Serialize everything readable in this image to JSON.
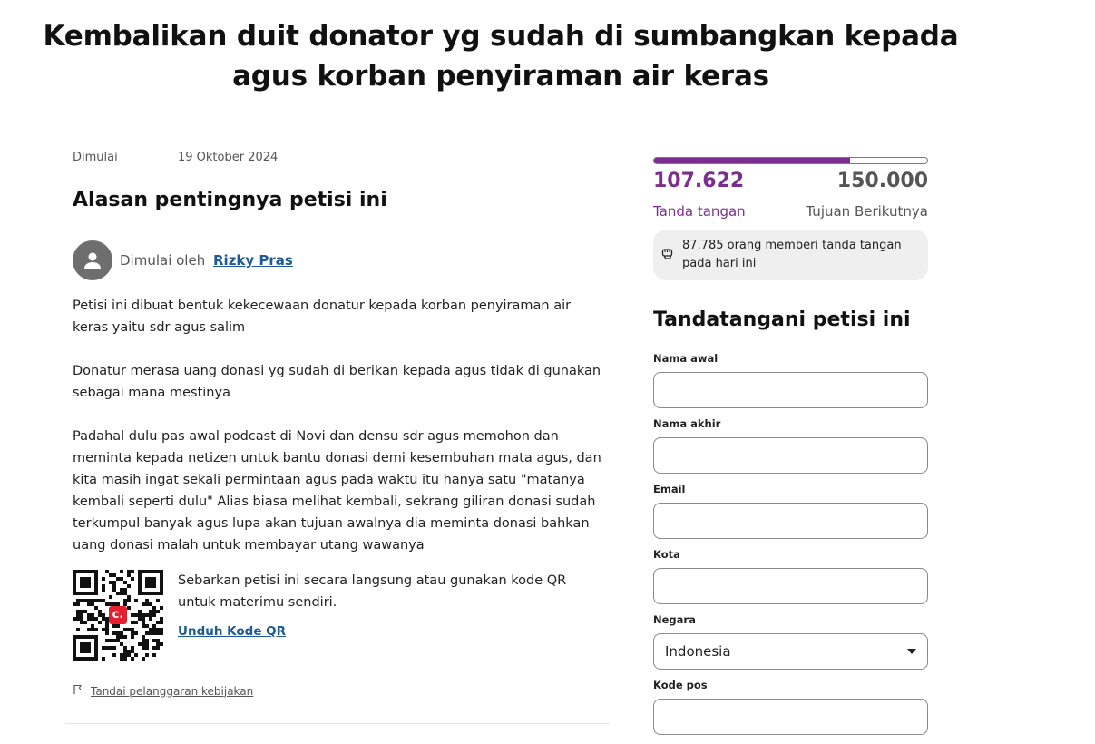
{
  "petition": {
    "title_line1": "Kembalikan duit donator yg sudah di sumbangkan kepada",
    "title_line2": "agus korban penyiraman air keras",
    "started_label": "Dimulai",
    "started_date": "19 Oktober 2024",
    "reason_title": "Alasan pentingnya petisi ini",
    "started_by_label": "Dimulai oleh",
    "author_name": "Rizky Pras",
    "paragraphs": [
      "Petisi ini dibuat bentuk kekecewaan donatur kepada korban penyiraman air keras yaitu sdr agus salim",
      "Donatur merasa uang donasi yg sudah di berikan kepada agus tidak di gunakan sebagai mana mestinya",
      "Padahal dulu pas awal podcast di Novi dan densu sdr agus memohon dan meminta kepada netizen untuk bantu donasi demi kesembuhan mata agus, dan kita masih ingat sekali permintaan agus pada waktu itu hanya satu \"matanya kembali seperti dulu\" Alias biasa melihat kembali, sekrang giliran donasi sudah terkumpul banyak agus lupa akan tujuan awalnya dia meminta donasi bahkan uang donasi malah untuk membayar utang wawanya"
    ],
    "qr_text": "Sebarkan petisi ini secara langsung atau gunakan kode QR untuk materimu sendiri.",
    "qr_download": "Unduh Kode QR",
    "qr_badge": "c.",
    "report_link": "Tandai pelanggaran kebijakan"
  },
  "progress": {
    "fraction": 0.7175,
    "count": "107.622",
    "count_label": "Tanda tangan",
    "goal": "150.000",
    "goal_label": "Tujuan Berikutnya",
    "today": "87.785 orang memberi tanda tangan pada hari ini"
  },
  "form": {
    "title": "Tandatangani petisi ini",
    "first_name_label": "Nama awal",
    "first_name_value": "",
    "last_name_label": "Nama akhir",
    "last_name_value": "",
    "email_label": "Email",
    "email_value": "",
    "city_label": "Kota",
    "city_value": "",
    "country_label": "Negara",
    "country_value": "Indonesia",
    "postal_label": "Kode pos",
    "postal_value": ""
  },
  "colors": {
    "brand": "#7b2e8e",
    "link": "#1d5a96",
    "badge": "#e5202e"
  },
  "icons": [
    "user-avatar-icon",
    "fist-icon",
    "flag-icon",
    "chevron-down-icon"
  ]
}
